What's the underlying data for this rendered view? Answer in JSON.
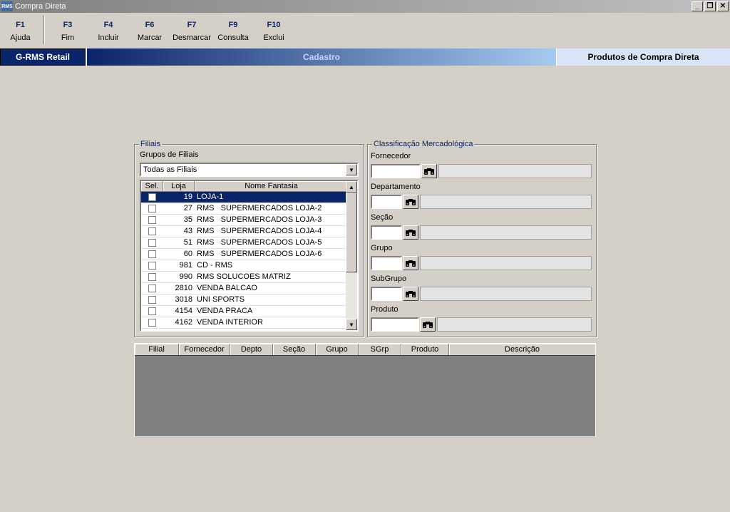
{
  "window": {
    "title": "Compra Direta",
    "app_icon": "RMS"
  },
  "fkeys": [
    {
      "key": "F1",
      "label": "Ajuda"
    },
    {
      "key": "F3",
      "label": "Fim"
    },
    {
      "key": "F4",
      "label": "Incluir"
    },
    {
      "key": "F6",
      "label": "Marcar"
    },
    {
      "key": "F7",
      "label": "Desmarcar"
    },
    {
      "key": "F9",
      "label": "Consulta"
    },
    {
      "key": "F10",
      "label": "Exclui"
    }
  ],
  "band": {
    "brand": "G-RMS Retail",
    "section": "Cadastro",
    "screen": "Produtos de Compra Direta"
  },
  "filiais": {
    "legend": "Filiais",
    "group_label": "Grupos de Filiais",
    "group_value": "Todas as Filiais",
    "columns": [
      "Sel.",
      "Loja",
      "Nome Fantasia"
    ],
    "rows": [
      {
        "loja": "19",
        "nome": "LOJA-1",
        "selected": true
      },
      {
        "loja": "27",
        "nome": "RMS   SUPERMERCADOS LOJA-2"
      },
      {
        "loja": "35",
        "nome": "RMS   SUPERMERCADOS LOJA-3"
      },
      {
        "loja": "43",
        "nome": "RMS   SUPERMERCADOS LOJA-4"
      },
      {
        "loja": "51",
        "nome": "RMS   SUPERMERCADOS LOJA-5"
      },
      {
        "loja": "60",
        "nome": "RMS   SUPERMERCADOS LOJA-6"
      },
      {
        "loja": "981",
        "nome": "CD - RMS"
      },
      {
        "loja": "990",
        "nome": "RMS SOLUCOES MATRIZ"
      },
      {
        "loja": "2810",
        "nome": "VENDA BALCAO"
      },
      {
        "loja": "3018",
        "nome": "UNI SPORTS"
      },
      {
        "loja": "4154",
        "nome": "VENDA PRACA"
      },
      {
        "loja": "4162",
        "nome": "VENDA INTERIOR"
      }
    ]
  },
  "classificacao": {
    "legend": "Classificação Mercadológica",
    "fields": [
      "Fornecedor",
      "Departamento",
      "Seção",
      "Grupo",
      "SubGrupo",
      "Produto"
    ]
  },
  "result_grid": {
    "columns": [
      "Filial",
      "Fornecedor",
      "Depto",
      "Seção",
      "Grupo",
      "SGrp",
      "Produto",
      "Descrição"
    ]
  }
}
